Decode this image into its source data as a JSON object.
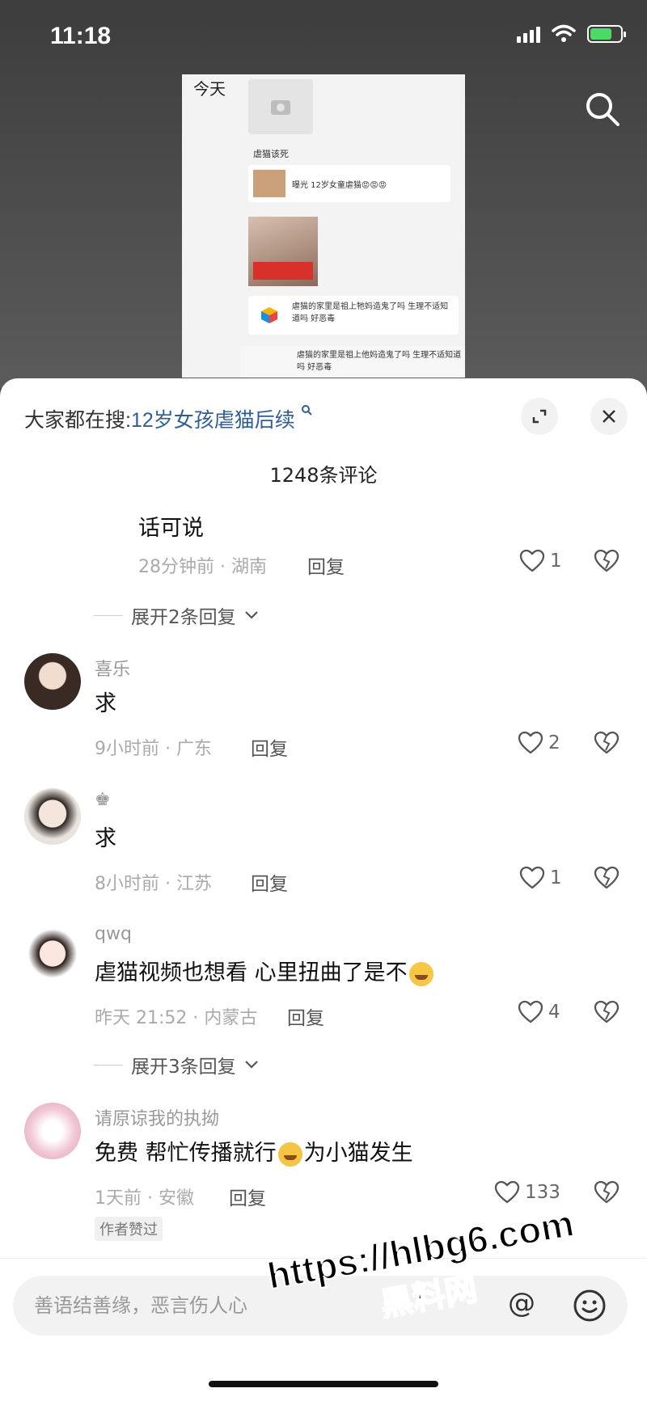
{
  "status_bar": {
    "time": "11:18"
  },
  "video_screenshot": {
    "day_label": "今天",
    "chat_title": "虐猫该死",
    "messages": [
      "曝光 12岁女童虐猫😡😡😡",
      "虐猫的家里是祖上牠妈造鬼了吗 生理不适知道吗 好恶毒",
      "虐猫的家里是祖上他妈造鬼了吗 生理不适知道吗 好恶毒"
    ]
  },
  "comment_sheet": {
    "hot_search_prefix": "大家都在搜:",
    "hot_search_term": "12岁女孩虐猫后续",
    "comment_count_title": "1248条评论",
    "comments": [
      {
        "username": "",
        "text": "话可说",
        "meta": "28分钟前 · 湖南",
        "reply": "回复",
        "likes": "1"
      },
      {
        "username": "喜乐",
        "text": "求",
        "meta": "9小时前 · 广东",
        "reply": "回复",
        "likes": "2"
      },
      {
        "username": "♚",
        "text": "求",
        "meta": "8小时前 · 江苏",
        "reply": "回复",
        "likes": "1"
      },
      {
        "username": "qwq",
        "text": "虐猫视频也想看 心里扭曲了是不",
        "meta": "昨天 21:52 · 内蒙古",
        "reply": "回复",
        "likes": "4"
      },
      {
        "username": "请原谅我的执拗",
        "text_part1": "免费 帮忙传播就行",
        "text_part2": "为小猫发生",
        "meta": "1天前 · 安徽",
        "reply": "回复",
        "likes": "133",
        "tag": "作者赞过"
      }
    ],
    "expand_replies": [
      "展开2条回复",
      "展开3条回复"
    ],
    "input_placeholder": "善语结善缘，恶言伤人心"
  },
  "watermark": {
    "url": "https://hlbg6.com",
    "text": "黑料网"
  }
}
